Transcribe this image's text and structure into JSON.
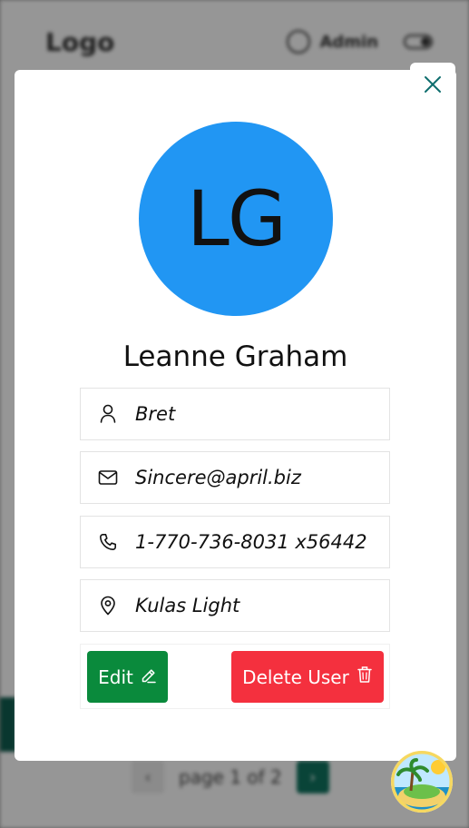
{
  "background": {
    "logo": "Logo",
    "admin_label": "Admin",
    "pagination_text": "page 1 of 2",
    "prev_symbol": "‹",
    "next_symbol": "›"
  },
  "modal": {
    "avatar_initials": "LG",
    "avatar_color": "#2196f3",
    "name": "Leanne Graham",
    "fields": [
      {
        "icon": "user-icon",
        "value": "Bret"
      },
      {
        "icon": "mail-icon",
        "value": "Sincere@april.biz"
      },
      {
        "icon": "phone-icon",
        "value": "1-770-736-8031 x56442"
      },
      {
        "icon": "location-pin-icon",
        "value": "Kulas Light"
      }
    ],
    "edit_label": "Edit",
    "delete_label": "Delete User",
    "edit_color": "#0a8a3c",
    "delete_color": "#f4303e",
    "close_icon": "close-icon"
  }
}
